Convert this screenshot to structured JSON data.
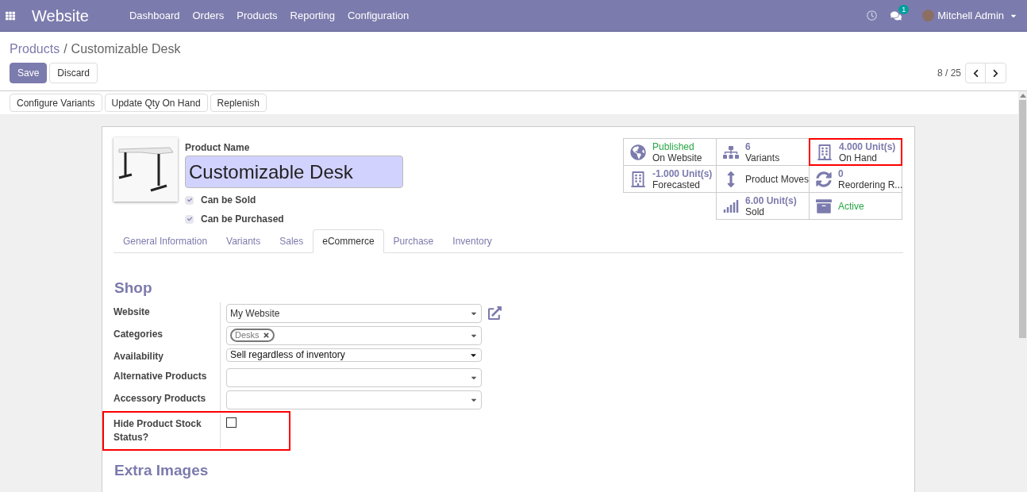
{
  "navbar": {
    "app_name": "Website",
    "menu": [
      "Dashboard",
      "Orders",
      "Products",
      "Reporting",
      "Configuration"
    ],
    "messages_badge": "1",
    "user": "Mitchell Admin"
  },
  "breadcrumb": {
    "parent": "Products",
    "separator": "/",
    "current": "Customizable Desk"
  },
  "buttons": [
    {
      "label": "Save",
      "kind": "primary"
    },
    {
      "label": "Discard",
      "kind": "secondary"
    }
  ],
  "pager": "8 / 25",
  "actions": [
    "Configure Variants",
    "Update Qty On Hand",
    "Replenish"
  ],
  "product": {
    "name_label": "Product Name",
    "name": "Customizable Desk",
    "options": [
      {
        "label": "Can be Sold",
        "checked": true
      },
      {
        "label": "Can be Purchased",
        "checked": true
      }
    ]
  },
  "stat_rows": [
    [
      {
        "kind": "globe",
        "value": "Published",
        "color": "#28a745",
        "label": "On Website",
        "highlighted": false
      },
      {
        "kind": "sitemap",
        "value": "6",
        "color": "#7c7bad",
        "label": "Variants",
        "highlighted": false
      },
      {
        "kind": "building",
        "value": "4.000 Unit(s)",
        "color": "#7c7bad",
        "label": "On Hand",
        "highlighted": true
      }
    ],
    [
      {
        "kind": "building",
        "value": "-1.000 Unit(s)",
        "color": "#7c7bad",
        "label": "Forecasted",
        "highlighted": false
      },
      {
        "kind": "arrows",
        "label": "Product Moves",
        "highlighted": false
      },
      {
        "kind": "refresh",
        "value": "0",
        "color": "#7c7bad",
        "label": "Reordering R...",
        "highlighted": false
      }
    ],
    [
      {
        "kind": "signal",
        "value": "6.00 Unit(s)",
        "color": "#7c7bad",
        "label": "Sold",
        "highlighted": false
      },
      {
        "kind": "archive",
        "value": "Active",
        "color": "#28a745",
        "highlighted": false
      }
    ]
  ],
  "tabs": [
    {
      "label": "General Information",
      "selected": false
    },
    {
      "label": "Variants",
      "selected": false
    },
    {
      "label": "Sales",
      "selected": false
    },
    {
      "label": "eCommerce",
      "selected": true
    },
    {
      "label": "Purchase",
      "selected": false
    },
    {
      "label": "Inventory",
      "selected": false
    }
  ],
  "section_title": "Shop",
  "fields": [
    {
      "label": "Website",
      "kind": "select",
      "value": "My Website",
      "external_link": true,
      "highlighted": false
    },
    {
      "label": "Categories",
      "kind": "tags",
      "tags": [
        "Desks"
      ],
      "highlighted": false
    },
    {
      "label": "Availability",
      "kind": "native",
      "value": "Sell regardless of inventory",
      "highlighted": false
    },
    {
      "label": "Alternative Products",
      "kind": "select",
      "highlighted": false
    },
    {
      "label": "Accessory Products",
      "kind": "select",
      "highlighted": false
    },
    {
      "label": "Hide Product Stock Status?",
      "kind": "checkbox",
      "checked": false,
      "highlighted": true
    }
  ],
  "next_section_title": "Extra Images"
}
